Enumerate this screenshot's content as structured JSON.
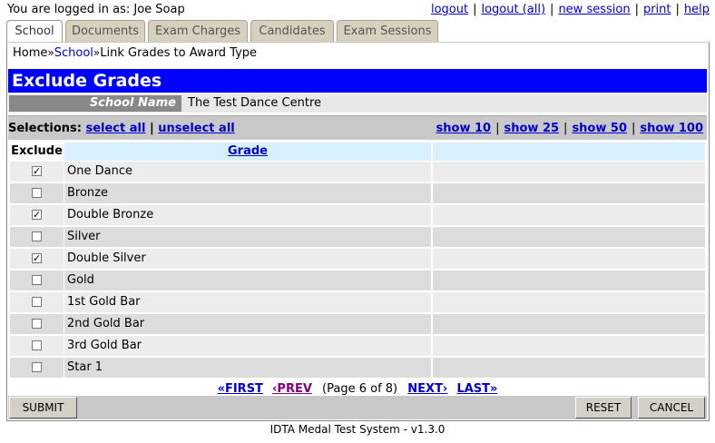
{
  "topbar": {
    "logged_in_label": "You are logged in as: Joe Soap",
    "links": [
      "logout",
      "logout (all)",
      "new session",
      "print",
      "help"
    ]
  },
  "tabs": [
    "School",
    "Documents",
    "Exam Charges",
    "Candidates",
    "Exam Sessions"
  ],
  "active_tab": "School",
  "breadcrumb": {
    "items": [
      "Home",
      "School",
      "Link Grades to Award Type"
    ],
    "separator": "»"
  },
  "page_title": "Exclude Grades",
  "school": {
    "label": "School Name",
    "value": "The Test Dance Centre"
  },
  "selections": {
    "label": "Selections:",
    "select_all": "select all",
    "divider": "|",
    "unselect_all": "unselect all",
    "page_sizes": [
      "show 10",
      "show 25",
      "show 50",
      "show 100"
    ]
  },
  "table": {
    "headers": {
      "exclude": "Exclude",
      "grade": "Grade"
    },
    "rows": [
      {
        "grade": "One Dance",
        "checked": true
      },
      {
        "grade": "Bronze",
        "checked": false
      },
      {
        "grade": "Double Bronze",
        "checked": true
      },
      {
        "grade": "Silver",
        "checked": false
      },
      {
        "grade": "Double Silver",
        "checked": true
      },
      {
        "grade": "Gold",
        "checked": false
      },
      {
        "grade": "1st Gold Bar",
        "checked": false
      },
      {
        "grade": "2nd Gold Bar",
        "checked": false
      },
      {
        "grade": "3rd Gold Bar",
        "checked": false
      },
      {
        "grade": "Star 1",
        "checked": false
      }
    ]
  },
  "pager": {
    "first": "«FIRST",
    "prev": "‹PREV",
    "info": "(Page 6 of 8)",
    "next": "NEXT›",
    "last": "LAST»"
  },
  "buttons": {
    "submit": "SUBMIT",
    "reset": "RESET",
    "cancel": "CANCEL"
  },
  "footer": "IDTA Medal Test System - v1.3.0",
  "colors": {
    "title_bar": "#0000ff",
    "link": "#0000cc",
    "header_cell": "#d8f0ff",
    "row_odd": "#ececec",
    "row_even": "#dcdcdc"
  }
}
